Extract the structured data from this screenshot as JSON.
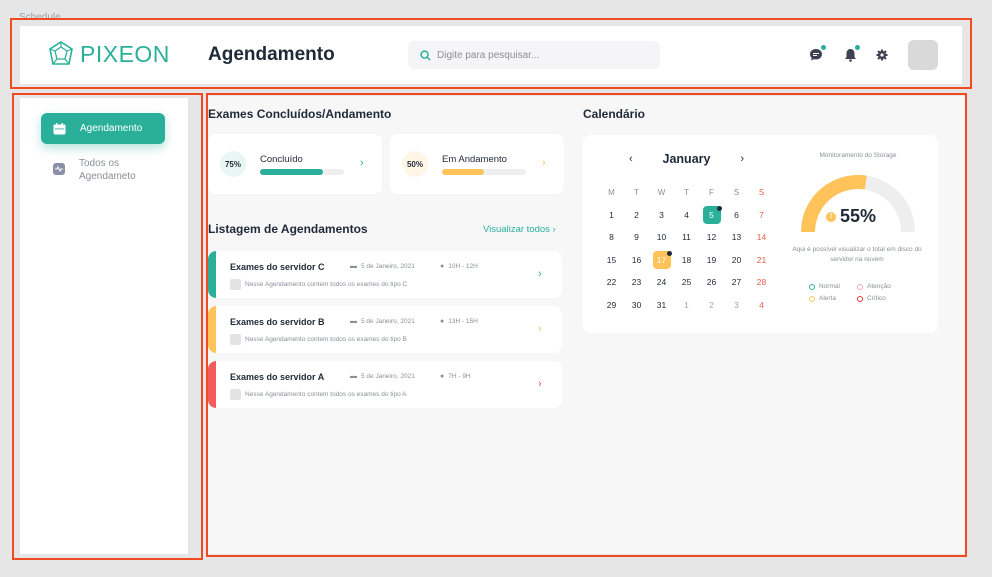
{
  "frame": {
    "label": "Schedule"
  },
  "header": {
    "logo_text": "PIXEON",
    "title": "Agendamento",
    "search_placeholder": "Digite para pesquisar..."
  },
  "sidebar": {
    "items": [
      {
        "label": "Agendamento",
        "active": true
      },
      {
        "label": "Todos os Agendameto",
        "active": false
      }
    ]
  },
  "exams": {
    "title": "Exames Concluídos/Andamento",
    "cards": [
      {
        "percent": "75%",
        "label": "Concluído",
        "progress": 0.75,
        "color": "#2ab09a",
        "bubble_bg": "#e9f7f4"
      },
      {
        "percent": "50%",
        "label": "Em Andamento",
        "progress": 0.5,
        "color": "#ffc35a",
        "bubble_bg": "#fff6e6"
      }
    ]
  },
  "schedules": {
    "title": "Listagem de Agendamentos",
    "see_all": "Visualizar todos ›",
    "items": [
      {
        "title": "Exames do servidor C",
        "date": "5 de Janeiro, 2021",
        "time": "10H - 12H",
        "desc": "Nesse Agendamento contem todos os exames do tipo C",
        "color": "#2ab09a"
      },
      {
        "title": "Exames do servidor B",
        "date": "5 de Janeiro, 2021",
        "time": "13H - 15H",
        "desc": "Nesse Agendamento contem todos os exames do tipo B",
        "color": "#ffc35a"
      },
      {
        "title": "Exames do servidor A",
        "date": "5 de Janeiro, 2021",
        "time": "7H - 9H",
        "desc": "Nesse Agendamento contem todos os exames do tipo A",
        "color": "#f25c5c"
      }
    ]
  },
  "calendar": {
    "title": "Calendário",
    "month": "January",
    "weekdays": [
      "M",
      "T",
      "W",
      "T",
      "F",
      "S",
      "S"
    ],
    "weeks": [
      [
        "1",
        "2",
        "3",
        "4",
        "5",
        "6",
        "7"
      ],
      [
        "8",
        "9",
        "10",
        "11",
        "12",
        "13",
        "14"
      ],
      [
        "15",
        "16",
        "17",
        "18",
        "19",
        "20",
        "21"
      ],
      [
        "22",
        "23",
        "24",
        "25",
        "26",
        "27",
        "28"
      ],
      [
        "29",
        "30",
        "31",
        "1",
        "2",
        "3",
        "4"
      ]
    ],
    "selected_green": "5",
    "selected_orange": "17"
  },
  "storage": {
    "title": "Monitoramento do Storage",
    "percent_label": "55%",
    "percent": 0.55,
    "note": "Aqui é possível visualizar o total em disco do servidor na nuvem",
    "legend": [
      {
        "label": "Normal",
        "color": "#2ab09a"
      },
      {
        "label": "Atenção",
        "color": "#f7a6b8"
      },
      {
        "label": "Alerta",
        "color": "#ffc35a"
      },
      {
        "label": "Crítico",
        "color": "#e03a3a"
      }
    ]
  }
}
